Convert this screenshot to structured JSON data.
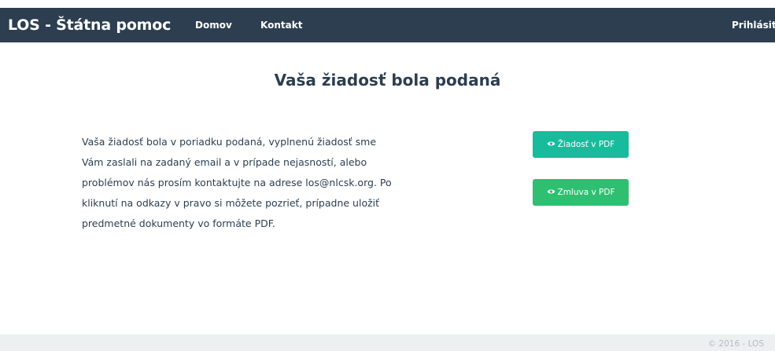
{
  "navbar": {
    "brand": "LOS - Štátna pomoc",
    "links": [
      {
        "label": "Domov"
      },
      {
        "label": "Kontakt"
      }
    ],
    "login_label": "Prihlásiť"
  },
  "main": {
    "title": "Vaša žiadosť bola podaná",
    "message_lines": [
      "Vaša žiadosť bola v poriadku podaná, vyplnenú žiadosť sme",
      "Vám zaslali na zadaný email a v prípade nejasností, alebo",
      "problémov nás prosím kontaktujte na adrese los@nlcsk.org. Po",
      "kliknutí na odkazy v pravo si môžete pozrieť, prípadne uložiť",
      "predmetné dokumenty vo formáte PDF."
    ],
    "buttons": {
      "request_pdf": {
        "label": "Žiadosť v PDF",
        "icon": "eye-icon"
      },
      "contract_pdf": {
        "label": "Zmluva v PDF",
        "icon": "eye-icon"
      }
    }
  },
  "footer": {
    "copyright": "© 2016 - LOS"
  },
  "colors": {
    "navbar": "#2c3e50",
    "primary_button": "#18bc9c",
    "secondary_button": "#2fbf71",
    "footer": "#ecf0f1",
    "footer_text": "#b4bcc2"
  }
}
